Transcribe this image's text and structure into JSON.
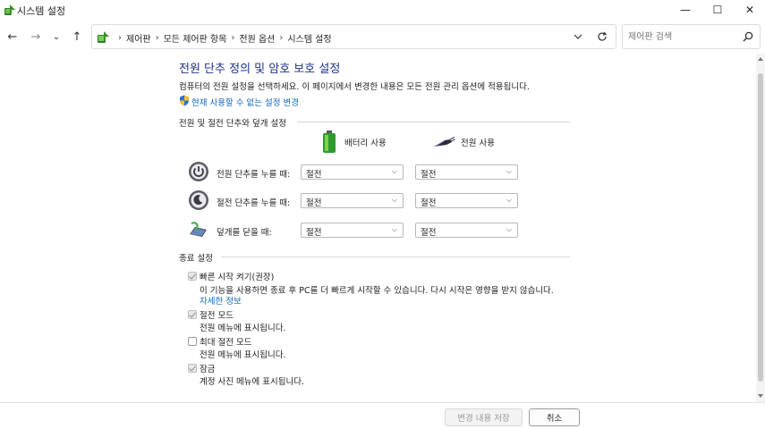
{
  "window": {
    "title": "시스템 설정",
    "minimize_glyph": "—",
    "maximize_glyph": "☐",
    "close_glyph": "✕"
  },
  "nav": {
    "back_glyph": "←",
    "forward_glyph": "→",
    "recent_glyph": "⌄",
    "up_glyph": "↑",
    "breadcrumbs": [
      "제어판",
      "모든 제어판 항목",
      "전원 옵션",
      "시스템 설정"
    ],
    "crumb_separator": "›",
    "search_placeholder": "제어판 검색"
  },
  "page": {
    "title": "전원 단추 정의 및 암호 보호 설정",
    "description": "컴퓨터의 전원 설정을 선택하세요. 이 페이지에서 변경한 내용은 모든 전원 관리 옵션에 적용됩니다.",
    "change_link": "현재 사용할 수 없는 설정 변경"
  },
  "buttons_section": {
    "heading": "전원 및 절전 단추와 덮개 설정",
    "columns": {
      "battery": "배터리 사용",
      "plugged": "전원 사용"
    },
    "rows": [
      {
        "icon": "power-button-icon",
        "label": "전원 단추를 누를 때:",
        "battery": "절전",
        "plugged": "절전"
      },
      {
        "icon": "sleep-button-icon",
        "label": "절전 단추를 누를 때:",
        "battery": "절전",
        "plugged": "절전"
      },
      {
        "icon": "laptop-lid-icon",
        "label": "덮개를 닫을 때:",
        "battery": "절전",
        "plugged": "절전"
      }
    ]
  },
  "shutdown_section": {
    "heading": "종료 설정",
    "items": [
      {
        "label": "빠른 시작 켜기(권장)",
        "description": "이 기능을 사용하면 종료 후 PC를 더 빠르게 시작할 수 있습니다. 다시 시작은 영향을 받지 않습니다.",
        "link": "자세한 정보",
        "checked": true
      },
      {
        "label": "절전 모드",
        "description": "전원 메뉴에 표시됩니다.",
        "checked": true
      },
      {
        "label": "최대 절전 모드",
        "description": "전원 메뉴에 표시됩니다.",
        "checked": false
      },
      {
        "label": "잠금",
        "description": "계정 사진 메뉴에 표시됩니다.",
        "checked": true
      }
    ]
  },
  "footer": {
    "save_label": "변경 내용 저장",
    "cancel_label": "취소"
  },
  "colors": {
    "title_blue": "#1e3287",
    "link_blue": "#1567c0"
  }
}
